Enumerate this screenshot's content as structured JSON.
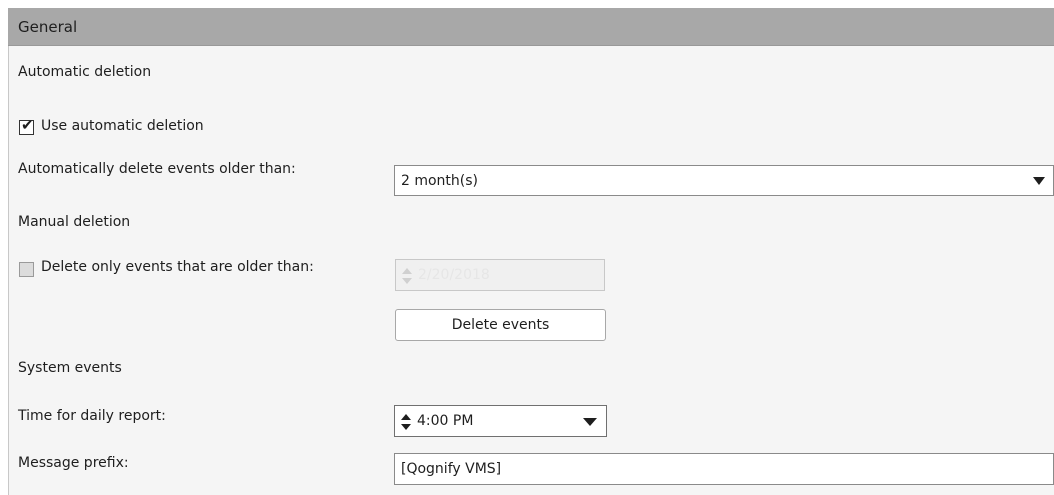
{
  "header": {
    "title": "General"
  },
  "sections": {
    "automatic_deletion": "Automatic deletion",
    "manual_deletion": "Manual deletion",
    "system_events": "System events"
  },
  "automatic": {
    "use_checkbox_label": "Use automatic deletion",
    "use_checked": true,
    "delete_older_label": "Automatically delete events older than:",
    "delete_older_value": "2 month(s)"
  },
  "manual": {
    "only_older_label": "Delete only events that are older than:",
    "only_older_checked": false,
    "only_older_value": "2/20/2018",
    "delete_button": "Delete events"
  },
  "system": {
    "daily_report_label": "Time for daily report:",
    "daily_report_value": "4:00 PM",
    "message_prefix_label": "Message prefix:",
    "message_prefix_value": "[Qognify VMS]"
  },
  "icons": {
    "dropdown": "chevron-down-icon",
    "spinner": "spinner-arrows-icon",
    "check": "checkmark-icon"
  }
}
